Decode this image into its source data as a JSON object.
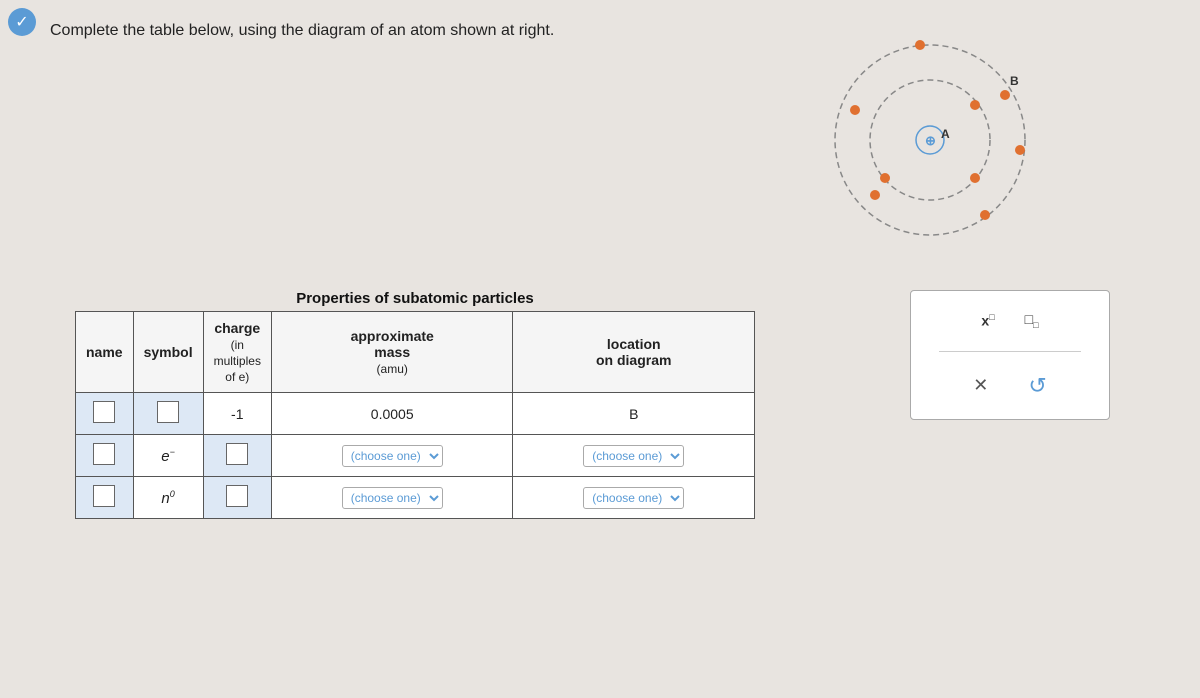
{
  "header": {
    "instruction": "Complete the table below, using the diagram of an atom shown at right."
  },
  "table": {
    "title": "Properties of subatomic particles",
    "columns": [
      "name",
      "symbol",
      "charge (in multiples of e)",
      "approximate mass (amu)",
      "location on diagram"
    ],
    "rows": [
      {
        "name_placeholder": "",
        "symbol_placeholder": "",
        "charge": "-1",
        "mass": "0.0005",
        "location": "B"
      },
      {
        "name_placeholder": "",
        "symbol": "e",
        "symbol_superscript": "-",
        "charge_placeholder": "",
        "mass_choose": "(choose one)",
        "location_choose": "(choose one)"
      },
      {
        "name_placeholder": "",
        "symbol": "n",
        "symbol_superscript": "0",
        "charge_placeholder": "",
        "mass_choose": "(choose one)",
        "location_choose": "(choose one)"
      }
    ]
  },
  "atom": {
    "label_a": "A",
    "label_b": "B"
  },
  "format_panel": {
    "superscript_label": "x²",
    "subscript_label": "x₂",
    "x_label": "×",
    "undo_label": "↺"
  },
  "top_check": "✓"
}
